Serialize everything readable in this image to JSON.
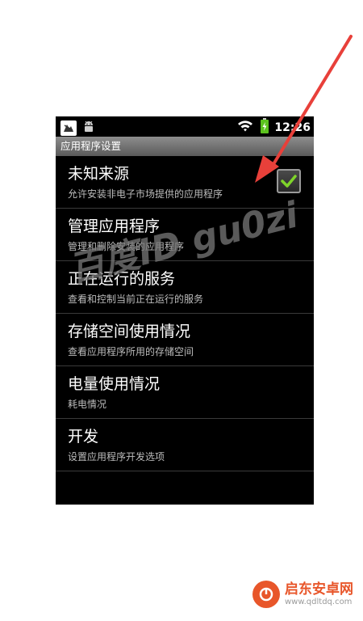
{
  "status_bar": {
    "time": "12:26",
    "icons": [
      "notification-icon",
      "android-debug-icon",
      "wifi-icon",
      "battery-charging-icon"
    ]
  },
  "title_bar": {
    "title": "应用程序设置"
  },
  "settings": {
    "items": [
      {
        "title": "未知来源",
        "summary": "允许安装非电子市场提供的应用程序",
        "checked": true
      },
      {
        "title": "管理应用程序",
        "summary": "管理和删除安装的应用程序"
      },
      {
        "title": "正在运行的服务",
        "summary": "查看和控制当前正在运行的服务"
      },
      {
        "title": "存储空间使用情况",
        "summary": "查看应用程序所用的存储空间"
      },
      {
        "title": "电量使用情况",
        "summary": "耗电情况"
      },
      {
        "title": "开发",
        "summary": "设置应用程序开发选项"
      }
    ]
  },
  "overlay": {
    "watermark": "百度ID gu0zi",
    "arrow_color": "#e8403a"
  },
  "footer": {
    "logo_name": "启东安卓网",
    "logo_url": "www.qdltdq.com"
  },
  "colors": {
    "screen_bg": "#000000",
    "title_bar": "#7a7a7a",
    "check": "#7fd42a",
    "accent": "#e8562a"
  }
}
